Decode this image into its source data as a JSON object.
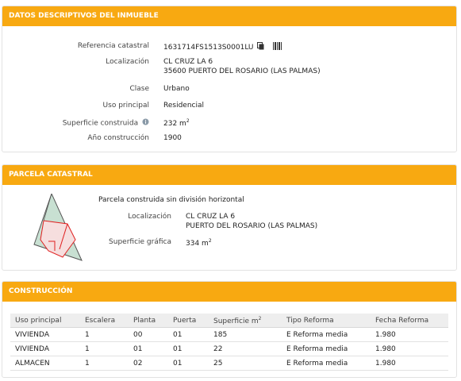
{
  "datos": {
    "title": "DATOS DESCRIPTIVOS DEL INMUEBLE",
    "ref_label": "Referencia catastral",
    "ref_value": "1631714FS1513S0001LU",
    "loc_label": "Localización",
    "loc_line1": "CL CRUZ LA 6",
    "loc_line2": "35600 PUERTO DEL ROSARIO (LAS PALMAS)",
    "clase_label": "Clase",
    "clase_value": "Urbano",
    "uso_label": "Uso principal",
    "uso_value": "Residencial",
    "sup_label": "Superficie construida",
    "sup_value": "232 m",
    "sup_unit_exp": "2",
    "anio_label": "Año construcción",
    "anio_value": "1900"
  },
  "parcela": {
    "title": "PARCELA CATASTRAL",
    "subtitle": "Parcela construida sin división horizontal",
    "loc_label": "Localización",
    "loc_line1": "CL CRUZ LA 6",
    "loc_line2": "PUERTO DEL ROSARIO (LAS PALMAS)",
    "sup_label": "Superficie gráfica",
    "sup_value": "334 m",
    "sup_unit_exp": "2"
  },
  "construccion": {
    "title": "CONSTRUCCIÓN",
    "headers": [
      "Uso principal",
      "Escalera",
      "Planta",
      "Puerta",
      "Superficie m",
      "Tipo Reforma",
      "Fecha Reforma"
    ],
    "sup_header_exp": "2",
    "rows": [
      [
        "VIVIENDA",
        "1",
        "00",
        "01",
        "185",
        "E Reforma media",
        "1.980"
      ],
      [
        "VIVIENDA",
        "1",
        "01",
        "01",
        "22",
        "E Reforma media",
        "1.980"
      ],
      [
        "ALMACEN",
        "1",
        "02",
        "01",
        "25",
        "E Reforma media",
        "1.980"
      ]
    ]
  },
  "icons": {
    "copy": "copy-icon",
    "barcode": "barcode-icon",
    "info": "info-icon"
  },
  "colors": {
    "header_bg": "#f8a911",
    "parcel_fill": "#c8e0d2",
    "building_outline": "#e02020"
  }
}
